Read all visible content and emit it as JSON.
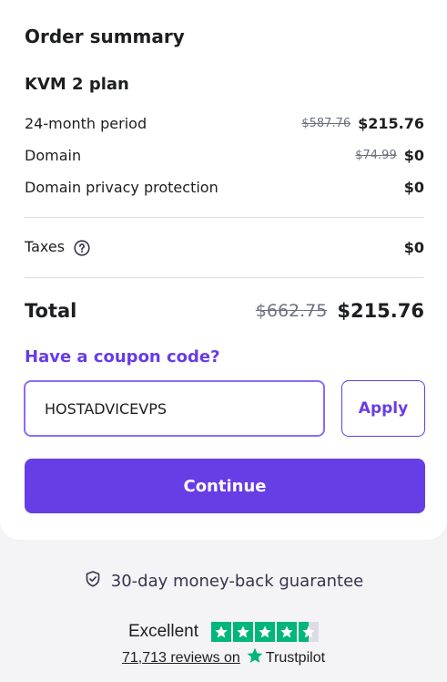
{
  "summary": {
    "title": "Order summary",
    "plan_name": "KVM 2 plan",
    "lines": [
      {
        "label": "24-month period",
        "old_price": "$587.76",
        "price": "$215.76"
      },
      {
        "label": "Domain",
        "old_price": "$74.99",
        "price": "$0"
      },
      {
        "label": "Domain privacy protection",
        "old_price": "",
        "price": "$0"
      }
    ],
    "taxes": {
      "label": "Taxes",
      "price": "$0"
    },
    "total": {
      "label": "Total",
      "old_price": "$662.75",
      "price": "$215.76"
    }
  },
  "coupon": {
    "link_label": "Have a coupon code?",
    "input_value": "HOSTADVICEVPS",
    "apply_label": "Apply"
  },
  "actions": {
    "continue_label": "Continue"
  },
  "guarantee": {
    "text": "30-day money-back guarantee",
    "icon": "shield-check-icon"
  },
  "trustpilot": {
    "rating_label": "Excellent",
    "reviews_label": "71,713 reviews on",
    "brand": "Trustpilot",
    "stars": 4.5
  },
  "colors": {
    "accent": "#673de6",
    "trustpilot_green": "#00b67a"
  }
}
